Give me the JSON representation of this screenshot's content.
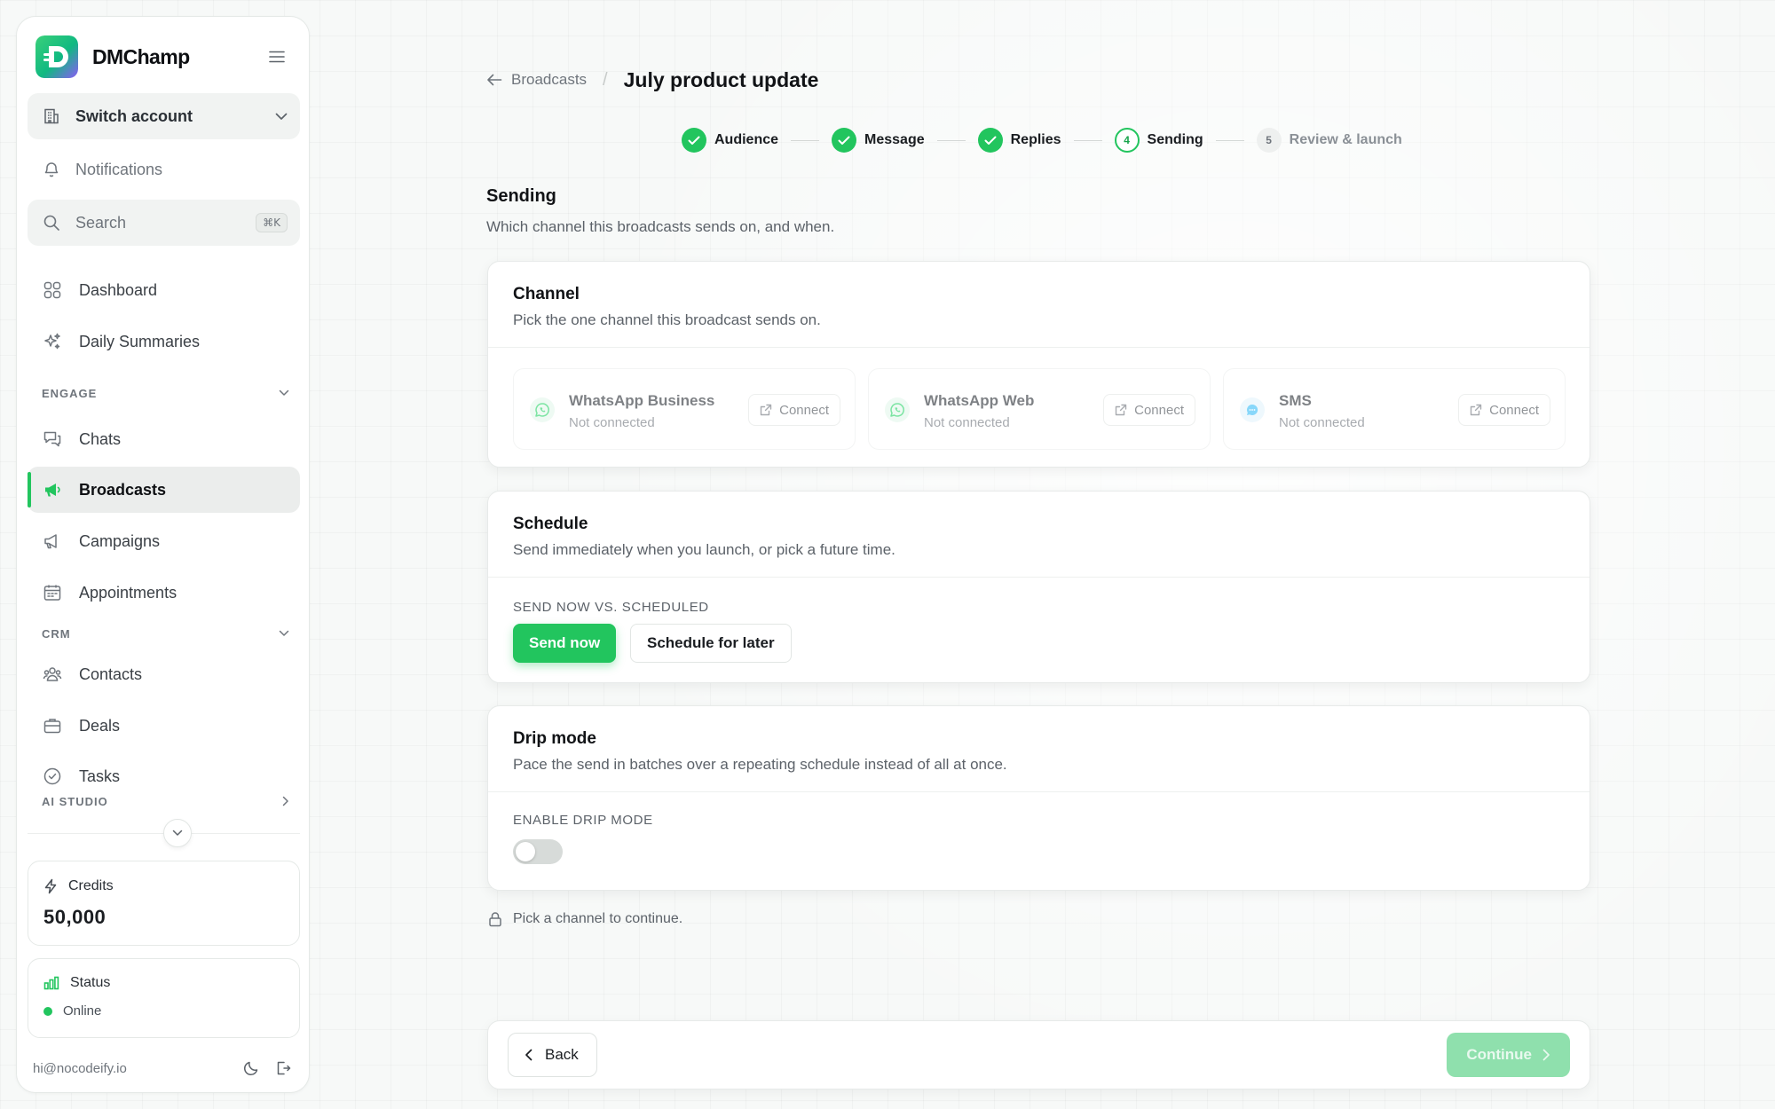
{
  "sidebar": {
    "brand": "DMChamp",
    "switch_account": "Switch account",
    "notifications": "Notifications",
    "search": {
      "label": "Search",
      "shortcut": "⌘K"
    },
    "items": {
      "dashboard": "Dashboard",
      "daily_summaries": "Daily Summaries",
      "chats": "Chats",
      "broadcasts": "Broadcasts",
      "campaigns": "Campaigns",
      "appointments": "Appointments",
      "contacts": "Contacts",
      "deals": "Deals",
      "tasks": "Tasks"
    },
    "sections": {
      "engage": "ENGAGE",
      "crm": "CRM",
      "ai_studio": "AI STUDIO"
    },
    "credits": {
      "label": "Credits",
      "value": "50,000"
    },
    "status": {
      "label": "Status",
      "value": "Online"
    },
    "email": "hi@nocodeify.io"
  },
  "breadcrumb": {
    "back": "Broadcasts",
    "title": "July product update"
  },
  "steps": [
    {
      "label": "Audience",
      "state": "done"
    },
    {
      "label": "Message",
      "state": "done"
    },
    {
      "label": "Replies",
      "state": "done"
    },
    {
      "label": "Sending",
      "number": "4",
      "state": "current"
    },
    {
      "label": "Review & launch",
      "number": "5",
      "state": "todo"
    }
  ],
  "sending": {
    "title": "Sending",
    "subtitle": "Which channel this broadcasts sends on, and when."
  },
  "channel_card": {
    "title": "Channel",
    "description": "Pick the one channel this broadcast sends on.",
    "options": [
      {
        "name": "WhatsApp Business",
        "status": "Not connected",
        "action": "Connect"
      },
      {
        "name": "WhatsApp Web",
        "status": "Not connected",
        "action": "Connect"
      },
      {
        "name": "SMS",
        "status": "Not connected",
        "action": "Connect"
      }
    ]
  },
  "schedule_card": {
    "title": "Schedule",
    "description": "Send immediately when you launch, or pick a future time.",
    "field_label": "SEND NOW VS. SCHEDULED",
    "send_now": "Send now",
    "schedule_later": "Schedule for later"
  },
  "drip_card": {
    "title": "Drip mode",
    "description": "Pace the send in batches over a repeating schedule instead of all at once.",
    "field_label": "ENABLE DRIP MODE",
    "enabled": false
  },
  "hint": "Pick a channel to continue.",
  "footer": {
    "back": "Back",
    "continue": "Continue"
  },
  "colors": {
    "accent": "#22c55e",
    "whatsapp": "#25d366",
    "sms": "#38bdf8"
  }
}
